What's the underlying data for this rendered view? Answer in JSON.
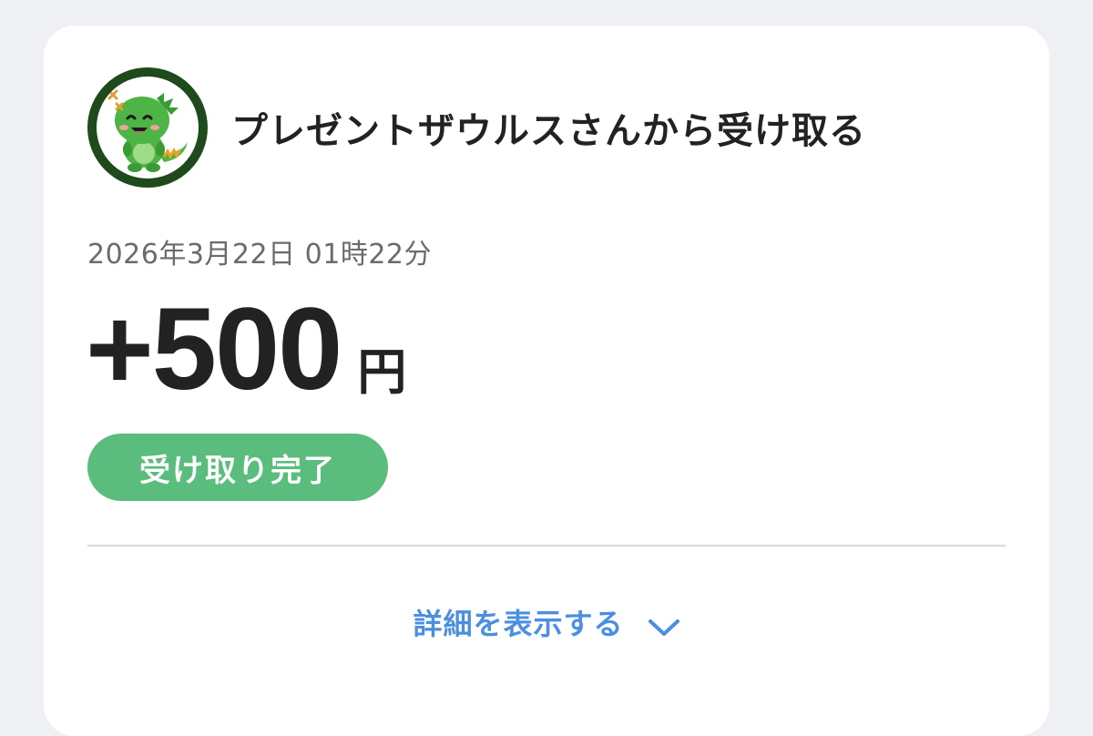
{
  "transaction": {
    "sender_title": "プレゼントザウルスさんから受け取る",
    "datetime": "2026年3月22日 01時22分",
    "amount": "+500",
    "currency": "円",
    "status": "受け取り完了",
    "details_label": "詳細を表示する"
  },
  "icons": {
    "avatar": "green-dinosaur-avatar-icon",
    "expand": "chevron-down-icon"
  },
  "colors": {
    "status_green": "#5bbd7d",
    "link_blue": "#4a8fe0",
    "avatar_ring": "#1f4a1c",
    "dino_green": "#4cb545"
  }
}
